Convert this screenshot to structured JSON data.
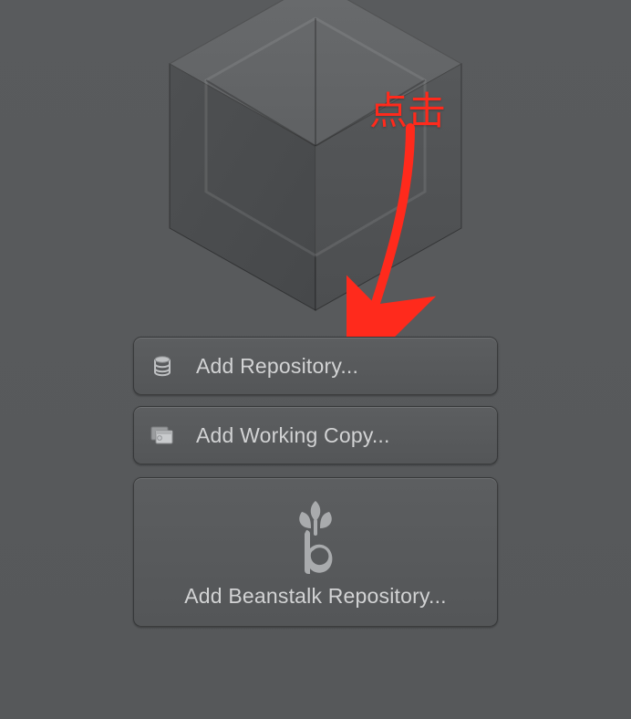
{
  "annotation": {
    "text": "点击"
  },
  "buttons": {
    "add_repository": "Add Repository...",
    "add_working_copy": "Add Working Copy...",
    "add_beanstalk": "Add Beanstalk Repository..."
  }
}
